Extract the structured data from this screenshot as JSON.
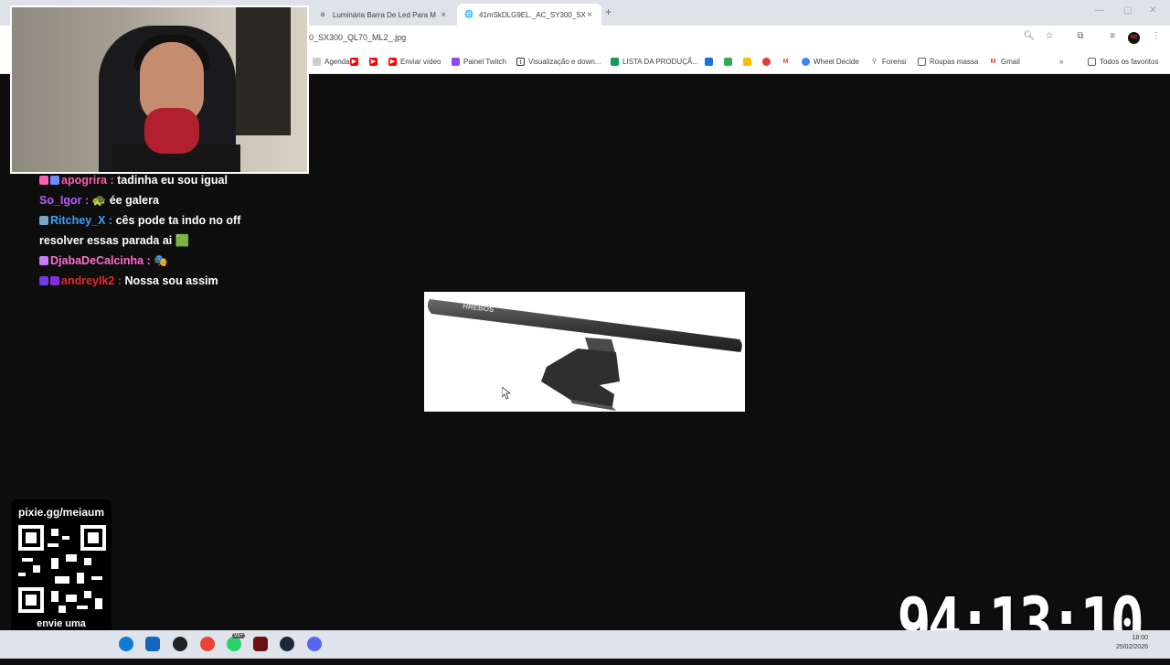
{
  "browser": {
    "tabs": [
      {
        "title": "Luminária Barra De Led Para M",
        "favicon": "a"
      },
      {
        "title": "41mSkDLG9EL._AC_SY300_SX3",
        "favicon": "🌐"
      }
    ],
    "url": "0_SX300_QL70_ML2_.jpg",
    "bookmarks": [
      {
        "label": "Agenda",
        "color": "#ffffff",
        "icon": "calendar-icon"
      },
      {
        "label": "",
        "color": "#ff0000",
        "icon": "youtube-icon"
      },
      {
        "label": "",
        "color": "#ff0000",
        "icon": "youtube-icon"
      },
      {
        "label": "Enviar vídeo",
        "color": "#ff0000",
        "icon": "youtube-icon"
      },
      {
        "label": "Painel Twitch",
        "color": "#9146ff",
        "icon": "twitch-icon"
      },
      {
        "label": "Visualização e down...",
        "color": "#333333",
        "icon": "t-icon"
      },
      {
        "label": "LISTA DA PRODUÇÃ...",
        "color": "#0f9d58",
        "icon": "sheets-icon"
      },
      {
        "label": "",
        "color": "#1a73e8",
        "icon": "outlook-icon"
      },
      {
        "label": "",
        "color": "#34a853",
        "icon": "drive-icon"
      },
      {
        "label": "",
        "color": "#fbbc04",
        "icon": "keep-icon"
      },
      {
        "label": "",
        "color": "#e53935",
        "icon": "app-icon"
      },
      {
        "label": "",
        "color": "#ea4335",
        "icon": "gmail-icon"
      },
      {
        "label": "Wheel Decide",
        "color": "#4285f4",
        "icon": "wheel-icon"
      },
      {
        "label": "Forensi",
        "color": "#5f6368",
        "icon": "search-icon"
      },
      {
        "label": "Roupas massa",
        "color": "#5f6368",
        "icon": "folder-icon"
      },
      {
        "label": "Gmail",
        "color": "#ea4335",
        "icon": "gmail-icon"
      }
    ],
    "all_bookmarks": "Todos os favoritos"
  },
  "chat": {
    "messages": [
      {
        "user": "apogrira",
        "user_color": "#ff5fb0",
        "text": "tadinha eu sou igual"
      },
      {
        "user": "So_Igor",
        "user_color": "#b65cff",
        "text": "🐢 ée galera"
      },
      {
        "user": "Ritchey_X",
        "user_color": "#3aa0ff",
        "text": "cês pode ta indo no off resolver essas parada ai 🟩"
      },
      {
        "user": "DjabaDeCalcinha",
        "user_color": "#ff6fcf",
        "text": "🎭"
      },
      {
        "user": "andreylk2",
        "user_color": "#e8272e",
        "text": "Nossa sou assim"
      }
    ]
  },
  "viewer": {
    "brand_text": "HREBOS"
  },
  "donation": {
    "url": "pixie.gg/meiaum",
    "caption": "envie uma contribuição"
  },
  "timer": "94:13:10",
  "taskbar": {
    "time": "18:00",
    "date": "25/02/2026",
    "notification_badge": "99+"
  }
}
